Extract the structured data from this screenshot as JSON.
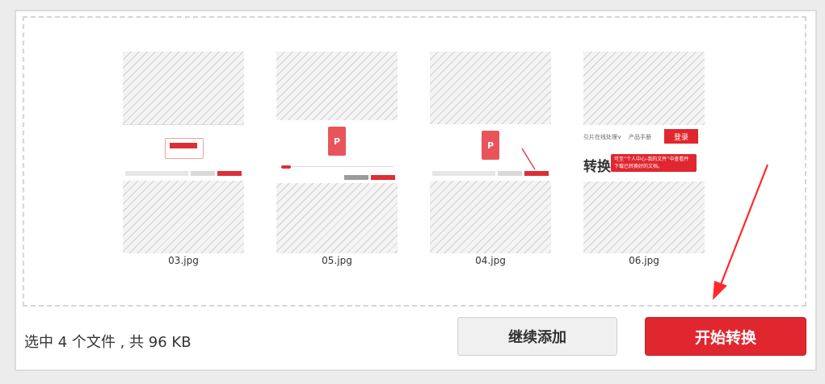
{
  "files": [
    {
      "name": "03.jpg"
    },
    {
      "name": "05.jpg"
    },
    {
      "name": "04.jpg"
    },
    {
      "name": "06.jpg",
      "preview": {
        "menu": "引片在线处理∨",
        "manual": "产品手册",
        "login": "登录",
        "heading": "转换",
        "tooltip": "可至“个人中心-我的文件”中查看件下载已转换好的文档。"
      }
    }
  ],
  "ppt_letter": "P",
  "status": "选中 4 个文件 , 共 96 KB",
  "buttons": {
    "add": "继续添加",
    "start": "开始转换"
  },
  "colors": {
    "accent": "#e0262f",
    "annotation_arrow": "#ff2a2a"
  }
}
